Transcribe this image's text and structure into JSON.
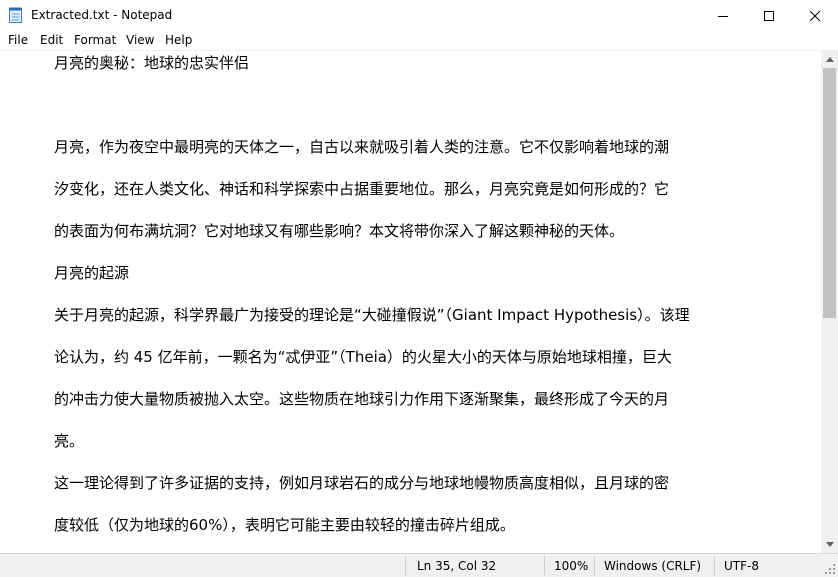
{
  "window": {
    "title": "Extracted.txt - Notepad",
    "icon": "notepad-icon",
    "controls": [
      "minimize-icon",
      "maximize-icon",
      "close-icon"
    ]
  },
  "menu": [
    "File",
    "Edit",
    "Format",
    "View",
    "Help"
  ],
  "document": {
    "lines": [
      "月亮的奥秘：地球的忠实伴侣",
      "",
      "月亮，作为夜空中最明亮的天体之一，自古以来就吸引着人类的注意。它不仅影响着地球的潮",
      "汐变化，还在人类文化、神话和科学探索中占据重要地位。那么，月亮究竟是如何形成的？它",
      "的表面为何布满坑洞？它对地球又有哪些影响？本文将带你深入了解这颗神秘的天体。",
      "月亮的起源",
      "关于月亮的起源，科学界最广为接受的理论是“大碰撞假说”（Giant Impact Hypothesis）。该理",
      "论认为，约 45 亿年前，一颗名为“忒伊亚”（Theia）的火星大小的天体与原始地球相撞，巨大",
      "的冲击力使大量物质被抛入太空。这些物质在地球引力作用下逐渐聚集，最终形成了今天的月",
      "亮。",
      "这一理论得到了许多证据的支持，例如月球岩石的成分与地球地幔物质高度相似，且月球的密",
      "度较低（仅为地球的60%），表明它可能主要由较轻的撞击碎片组成。"
    ]
  },
  "status": {
    "position": "Ln 35, Col 32",
    "zoom": "100%",
    "line_ending": "Windows (CRLF)",
    "encoding": "UTF-8"
  }
}
